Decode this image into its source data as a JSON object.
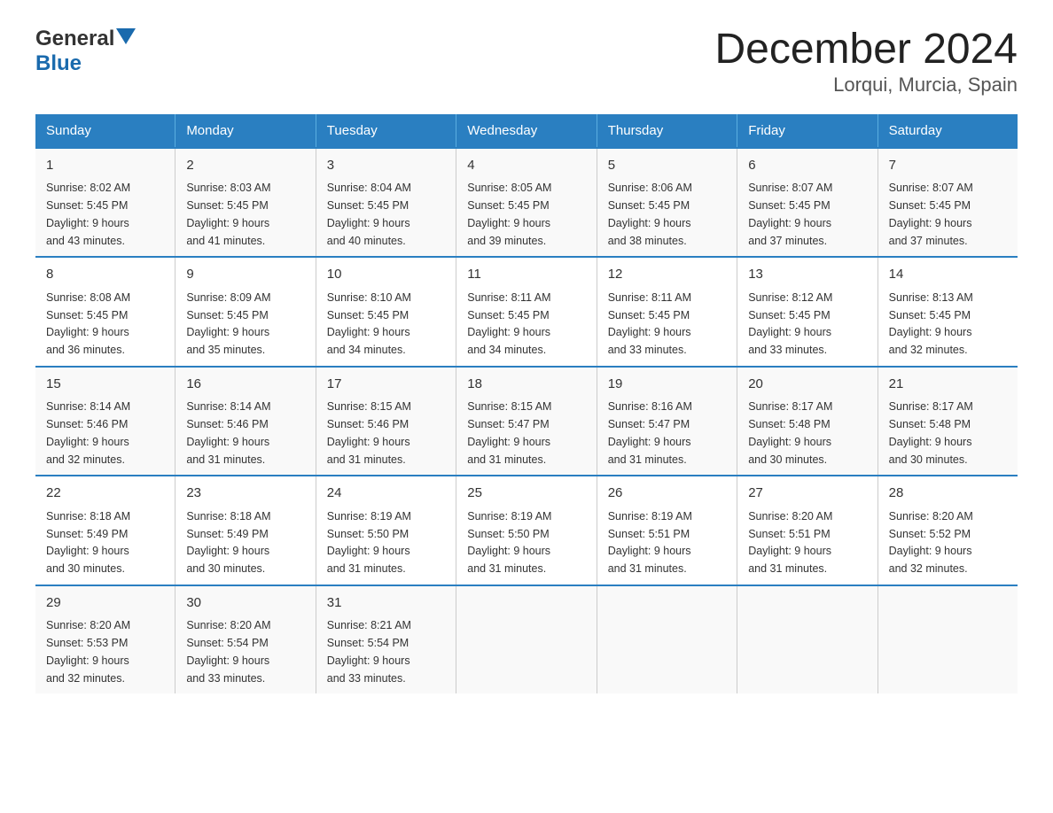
{
  "header": {
    "logo_general": "General",
    "logo_blue": "Blue",
    "title": "December 2024",
    "subtitle": "Lorqui, Murcia, Spain"
  },
  "days_of_week": [
    "Sunday",
    "Monday",
    "Tuesday",
    "Wednesday",
    "Thursday",
    "Friday",
    "Saturday"
  ],
  "weeks": [
    [
      {
        "day": "1",
        "sunrise": "8:02 AM",
        "sunset": "5:45 PM",
        "daylight": "9 hours and 43 minutes."
      },
      {
        "day": "2",
        "sunrise": "8:03 AM",
        "sunset": "5:45 PM",
        "daylight": "9 hours and 41 minutes."
      },
      {
        "day": "3",
        "sunrise": "8:04 AM",
        "sunset": "5:45 PM",
        "daylight": "9 hours and 40 minutes."
      },
      {
        "day": "4",
        "sunrise": "8:05 AM",
        "sunset": "5:45 PM",
        "daylight": "9 hours and 39 minutes."
      },
      {
        "day": "5",
        "sunrise": "8:06 AM",
        "sunset": "5:45 PM",
        "daylight": "9 hours and 38 minutes."
      },
      {
        "day": "6",
        "sunrise": "8:07 AM",
        "sunset": "5:45 PM",
        "daylight": "9 hours and 37 minutes."
      },
      {
        "day": "7",
        "sunrise": "8:07 AM",
        "sunset": "5:45 PM",
        "daylight": "9 hours and 37 minutes."
      }
    ],
    [
      {
        "day": "8",
        "sunrise": "8:08 AM",
        "sunset": "5:45 PM",
        "daylight": "9 hours and 36 minutes."
      },
      {
        "day": "9",
        "sunrise": "8:09 AM",
        "sunset": "5:45 PM",
        "daylight": "9 hours and 35 minutes."
      },
      {
        "day": "10",
        "sunrise": "8:10 AM",
        "sunset": "5:45 PM",
        "daylight": "9 hours and 34 minutes."
      },
      {
        "day": "11",
        "sunrise": "8:11 AM",
        "sunset": "5:45 PM",
        "daylight": "9 hours and 34 minutes."
      },
      {
        "day": "12",
        "sunrise": "8:11 AM",
        "sunset": "5:45 PM",
        "daylight": "9 hours and 33 minutes."
      },
      {
        "day": "13",
        "sunrise": "8:12 AM",
        "sunset": "5:45 PM",
        "daylight": "9 hours and 33 minutes."
      },
      {
        "day": "14",
        "sunrise": "8:13 AM",
        "sunset": "5:45 PM",
        "daylight": "9 hours and 32 minutes."
      }
    ],
    [
      {
        "day": "15",
        "sunrise": "8:14 AM",
        "sunset": "5:46 PM",
        "daylight": "9 hours and 32 minutes."
      },
      {
        "day": "16",
        "sunrise": "8:14 AM",
        "sunset": "5:46 PM",
        "daylight": "9 hours and 31 minutes."
      },
      {
        "day": "17",
        "sunrise": "8:15 AM",
        "sunset": "5:46 PM",
        "daylight": "9 hours and 31 minutes."
      },
      {
        "day": "18",
        "sunrise": "8:15 AM",
        "sunset": "5:47 PM",
        "daylight": "9 hours and 31 minutes."
      },
      {
        "day": "19",
        "sunrise": "8:16 AM",
        "sunset": "5:47 PM",
        "daylight": "9 hours and 31 minutes."
      },
      {
        "day": "20",
        "sunrise": "8:17 AM",
        "sunset": "5:48 PM",
        "daylight": "9 hours and 30 minutes."
      },
      {
        "day": "21",
        "sunrise": "8:17 AM",
        "sunset": "5:48 PM",
        "daylight": "9 hours and 30 minutes."
      }
    ],
    [
      {
        "day": "22",
        "sunrise": "8:18 AM",
        "sunset": "5:49 PM",
        "daylight": "9 hours and 30 minutes."
      },
      {
        "day": "23",
        "sunrise": "8:18 AM",
        "sunset": "5:49 PM",
        "daylight": "9 hours and 30 minutes."
      },
      {
        "day": "24",
        "sunrise": "8:19 AM",
        "sunset": "5:50 PM",
        "daylight": "9 hours and 31 minutes."
      },
      {
        "day": "25",
        "sunrise": "8:19 AM",
        "sunset": "5:50 PM",
        "daylight": "9 hours and 31 minutes."
      },
      {
        "day": "26",
        "sunrise": "8:19 AM",
        "sunset": "5:51 PM",
        "daylight": "9 hours and 31 minutes."
      },
      {
        "day": "27",
        "sunrise": "8:20 AM",
        "sunset": "5:51 PM",
        "daylight": "9 hours and 31 minutes."
      },
      {
        "day": "28",
        "sunrise": "8:20 AM",
        "sunset": "5:52 PM",
        "daylight": "9 hours and 32 minutes."
      }
    ],
    [
      {
        "day": "29",
        "sunrise": "8:20 AM",
        "sunset": "5:53 PM",
        "daylight": "9 hours and 32 minutes."
      },
      {
        "day": "30",
        "sunrise": "8:20 AM",
        "sunset": "5:54 PM",
        "daylight": "9 hours and 33 minutes."
      },
      {
        "day": "31",
        "sunrise": "8:21 AM",
        "sunset": "5:54 PM",
        "daylight": "9 hours and 33 minutes."
      },
      null,
      null,
      null,
      null
    ]
  ]
}
